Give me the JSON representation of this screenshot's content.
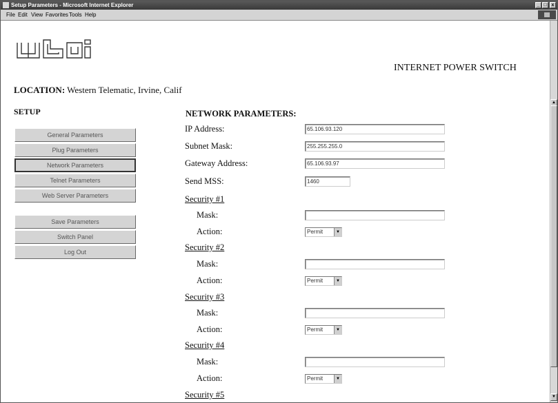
{
  "window": {
    "title": "Setup Parameters - Microsoft Internet Explorer",
    "minimize": "_",
    "maximize": "□",
    "close": "x"
  },
  "menu": [
    "File",
    "Edit",
    "View",
    "Favorites",
    "Tools",
    "Help"
  ],
  "header": {
    "logo_text": "wti",
    "app_title": "INTERNET POWER SWITCH",
    "location_label": "LOCATION:",
    "location_value": "Western Telematic, Irvine, Calif"
  },
  "setup": {
    "title": "SETUP",
    "nav": [
      "General Parameters",
      "Plug Parameters",
      "Network Parameters",
      "Telnet Parameters",
      "Web Server Parameters"
    ],
    "actions": [
      "Save Parameters",
      "Switch Panel",
      "Log Out"
    ]
  },
  "network": {
    "title": "NETWORK PARAMETERS:",
    "fields": [
      {
        "label": "IP Address:",
        "value": "65.106.93.120"
      },
      {
        "label": "Subnet Mask:",
        "value": "255.255.255.0"
      },
      {
        "label": "Gateway Address:",
        "value": "65.106.93.97"
      },
      {
        "label": "Send MSS:",
        "value": "1460"
      }
    ],
    "security": [
      {
        "label": "Security #1",
        "mask_label": "Mask:",
        "mask_value": "",
        "action_label": "Action:",
        "action_value": "Permit"
      },
      {
        "label": "Security #2",
        "mask_label": "Mask:",
        "mask_value": "",
        "action_label": "Action:",
        "action_value": "Permit"
      },
      {
        "label": "Security #3",
        "mask_label": "Mask:",
        "mask_value": "",
        "action_label": "Action:",
        "action_value": "Permit"
      },
      {
        "label": "Security #4",
        "mask_label": "Mask:",
        "mask_value": "",
        "action_label": "Action:",
        "action_value": "Permit"
      },
      {
        "label": "Security #5"
      }
    ]
  },
  "icons": {
    "dropdown": "chevron-down-icon",
    "scroll_up": "arrow-up-icon",
    "scroll_down": "arrow-down-icon"
  }
}
